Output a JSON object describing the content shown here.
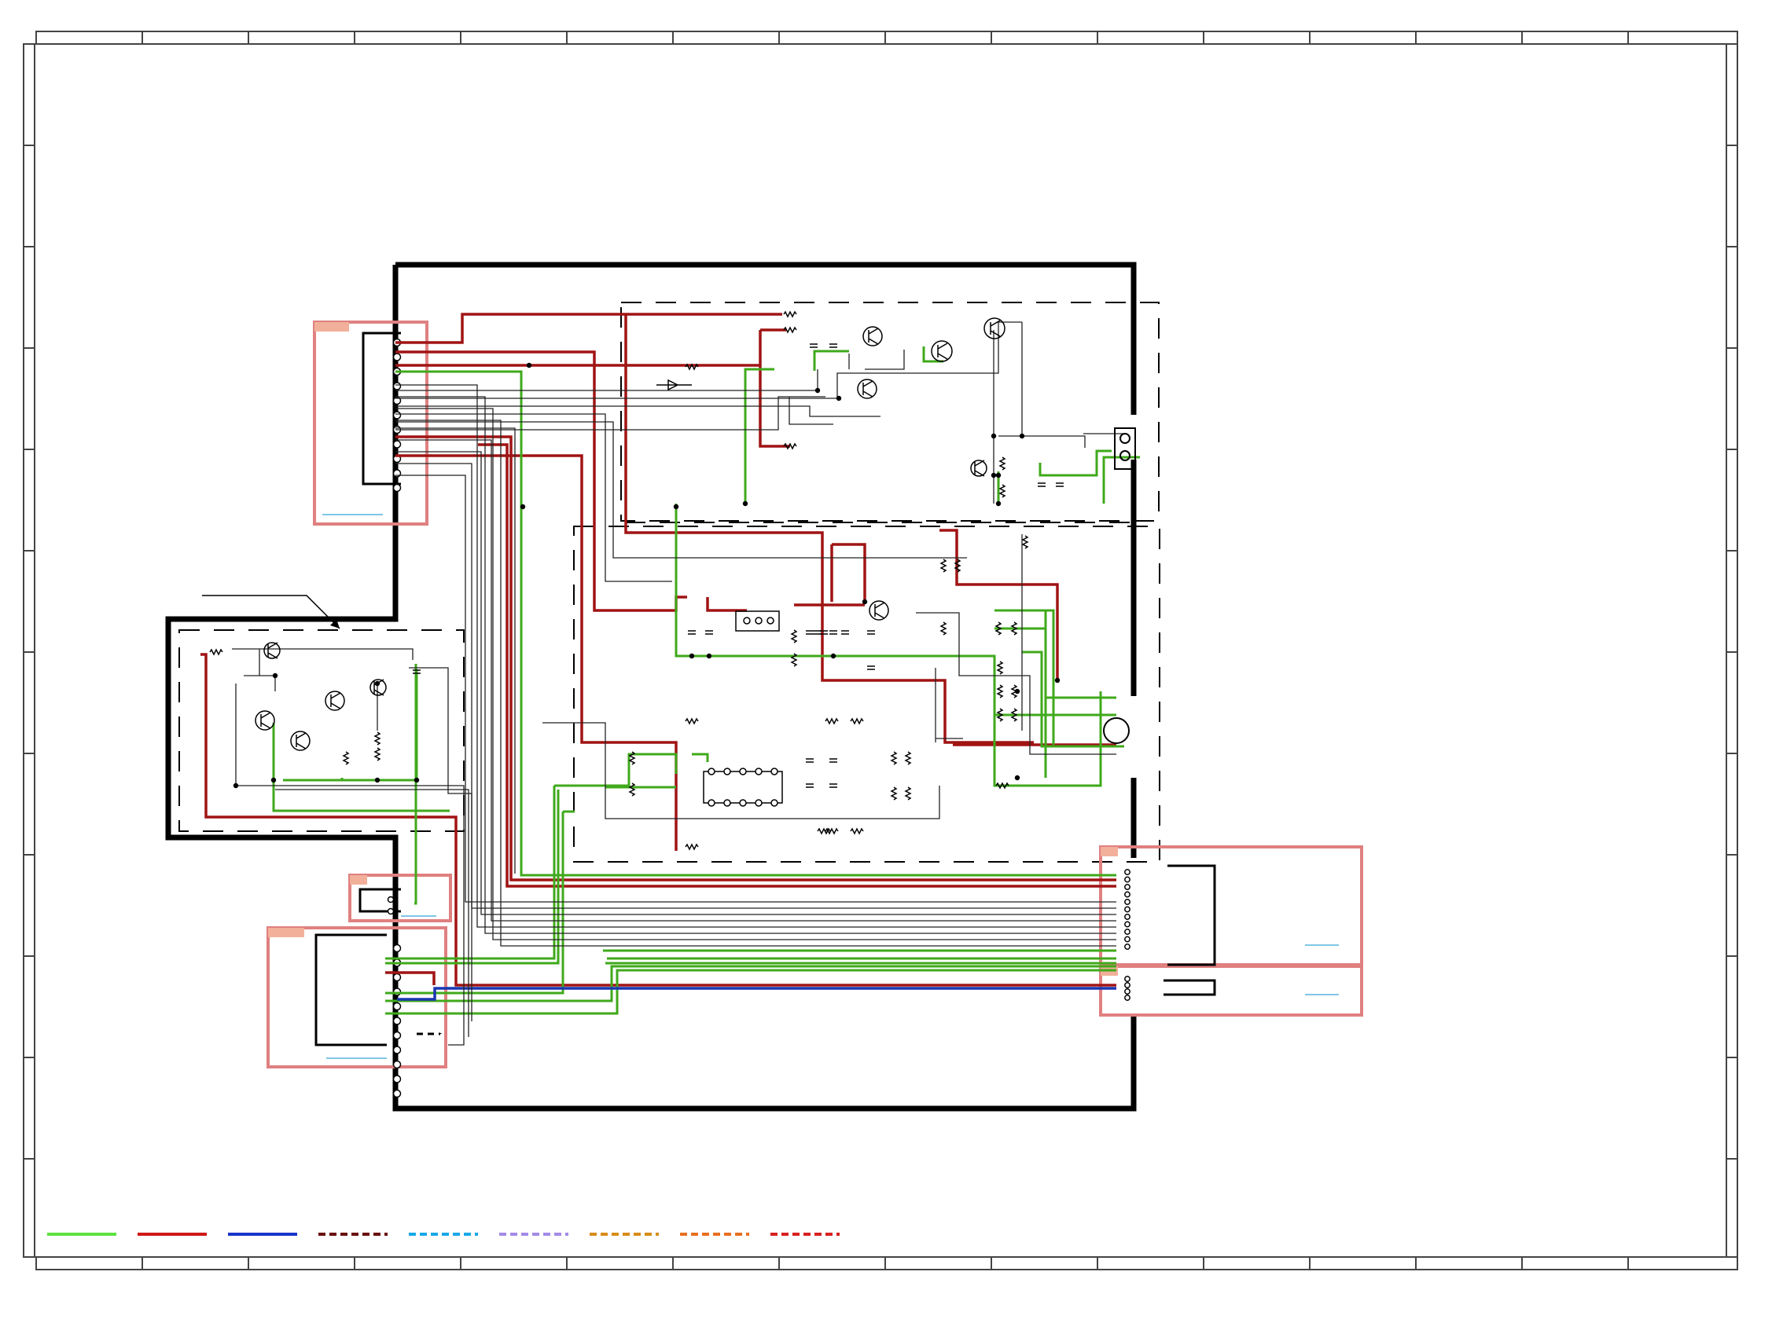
{
  "diagram": {
    "kind": "schematic-wiring-diagram",
    "colors": {
      "frame": "#000000",
      "green_signal": "#3fa91b",
      "red_signal": "#a01414",
      "blue_signal": "#1a37b0",
      "connector_outline": "#e08080",
      "connector_tab": "#f2b09a",
      "link_underline": "#7fc6e6",
      "thin_wire": "#222222"
    },
    "legend": [
      {
        "icon": "solid-line",
        "color": "#5fe040"
      },
      {
        "icon": "solid-line",
        "color": "#d01818"
      },
      {
        "icon": "solid-line",
        "color": "#1a35c8"
      },
      {
        "icon": "dashed-line",
        "color": "#6a1010"
      },
      {
        "icon": "dashed-line",
        "color": "#18a8e8"
      },
      {
        "icon": "dashed-line",
        "color": "#a48ae8"
      },
      {
        "icon": "dashed-line",
        "color": "#d88c18"
      },
      {
        "icon": "dashed-line",
        "color": "#e87020"
      },
      {
        "icon": "dashed-line",
        "color": "#d82020"
      }
    ]
  }
}
